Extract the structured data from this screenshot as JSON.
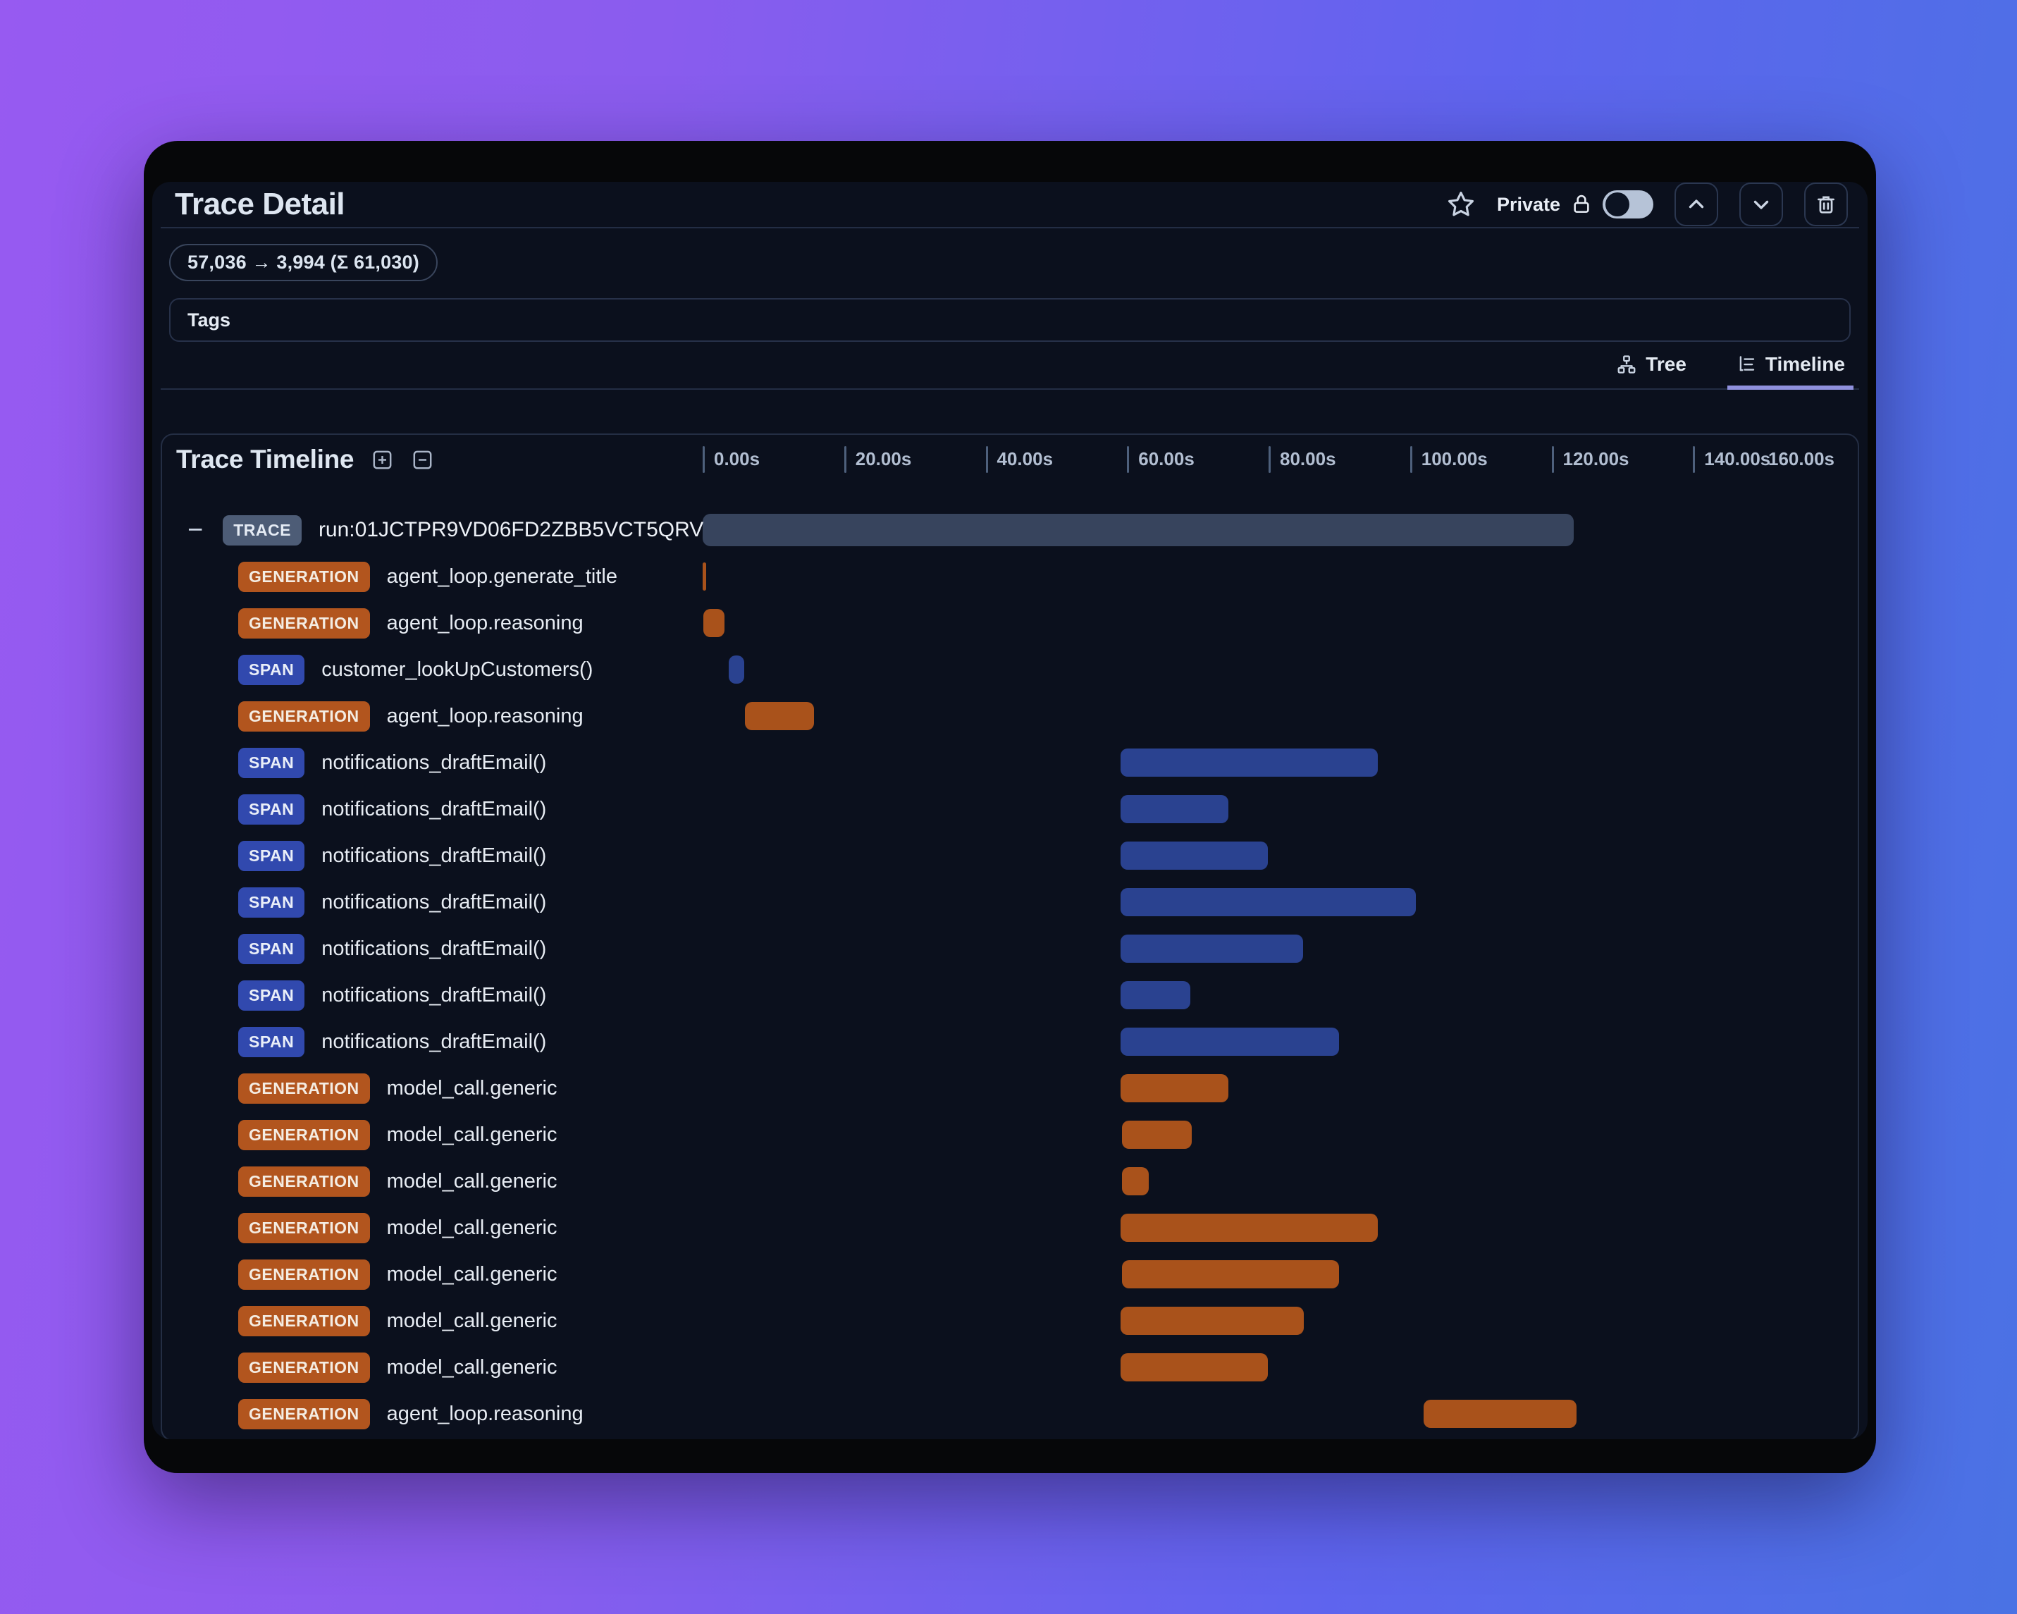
{
  "header": {
    "title": "Trace Detail",
    "privacy_label": "Private",
    "bookmark_icon": "star-icon",
    "lock_icon": "lock-icon",
    "toggle_state": "off",
    "actions": {
      "up": "chevron-up",
      "down": "chevron-down",
      "delete": "trash"
    }
  },
  "token_usage": "57,036 → 3,994 (Σ 61,030)",
  "tags": {
    "label": "Tags"
  },
  "view_tabs": [
    {
      "label": "Tree",
      "active": false
    },
    {
      "label": "Timeline",
      "active": true
    }
  ],
  "timeline": {
    "title": "Trace Timeline",
    "axis": {
      "ticks": [
        "0.00s",
        "20.00s",
        "40.00s",
        "60.00s",
        "80.00s",
        "100.00s",
        "120.00s",
        "140.00s",
        "160.00s"
      ],
      "min_s": 0,
      "max_s": 160,
      "step_s": 20
    },
    "rows": [
      {
        "type": "TRACE",
        "kind": "trace",
        "badge": "TRACE",
        "label": "run:01JCTPR9VD06FD2ZBB5VCT5QRV",
        "start_s": 0.0,
        "end_s": 123.1
      },
      {
        "type": "GENERATION",
        "kind": "generation",
        "badge": "GENERATION",
        "label": "agent_loop.generate_title",
        "start_s": 0.0,
        "end_s": 0.5
      },
      {
        "type": "GENERATION",
        "kind": "generation",
        "badge": "GENERATION",
        "label": "agent_loop.reasoning",
        "start_s": 0.1,
        "end_s": 3.1
      },
      {
        "type": "SPAN",
        "kind": "span",
        "badge": "SPAN",
        "label": "customer_lookUpCustomers()",
        "start_s": 3.7,
        "end_s": 5.9
      },
      {
        "type": "GENERATION",
        "kind": "generation",
        "badge": "GENERATION",
        "label": "agent_loop.reasoning",
        "start_s": 6.0,
        "end_s": 15.7
      },
      {
        "type": "SPAN",
        "kind": "span",
        "badge": "SPAN",
        "label": "notifications_draftEmail()",
        "start_s": 59.1,
        "end_s": 95.4
      },
      {
        "type": "SPAN",
        "kind": "span",
        "badge": "SPAN",
        "label": "notifications_draftEmail()",
        "start_s": 59.1,
        "end_s": 74.3
      },
      {
        "type": "SPAN",
        "kind": "span",
        "badge": "SPAN",
        "label": "notifications_draftEmail()",
        "start_s": 59.1,
        "end_s": 79.9
      },
      {
        "type": "SPAN",
        "kind": "span",
        "badge": "SPAN",
        "label": "notifications_draftEmail()",
        "start_s": 59.1,
        "end_s": 100.8
      },
      {
        "type": "SPAN",
        "kind": "span",
        "badge": "SPAN",
        "label": "notifications_draftEmail()",
        "start_s": 59.1,
        "end_s": 84.9
      },
      {
        "type": "SPAN",
        "kind": "span",
        "badge": "SPAN",
        "label": "notifications_draftEmail()",
        "start_s": 59.1,
        "end_s": 68.9
      },
      {
        "type": "SPAN",
        "kind": "span",
        "badge": "SPAN",
        "label": "notifications_draftEmail()",
        "start_s": 59.1,
        "end_s": 90.0
      },
      {
        "type": "GENERATION",
        "kind": "generation",
        "badge": "GENERATION",
        "label": "model_call.generic",
        "start_s": 59.1,
        "end_s": 74.3
      },
      {
        "type": "GENERATION",
        "kind": "generation",
        "badge": "GENERATION",
        "label": "model_call.generic",
        "start_s": 59.3,
        "end_s": 69.1
      },
      {
        "type": "GENERATION",
        "kind": "generation",
        "badge": "GENERATION",
        "label": "model_call.generic",
        "start_s": 59.3,
        "end_s": 63.1
      },
      {
        "type": "GENERATION",
        "kind": "generation",
        "badge": "GENERATION",
        "label": "model_call.generic",
        "start_s": 59.1,
        "end_s": 95.4
      },
      {
        "type": "GENERATION",
        "kind": "generation",
        "badge": "GENERATION",
        "label": "model_call.generic",
        "start_s": 59.3,
        "end_s": 90.0
      },
      {
        "type": "GENERATION",
        "kind": "generation",
        "badge": "GENERATION",
        "label": "model_call.generic",
        "start_s": 59.1,
        "end_s": 85.0
      },
      {
        "type": "GENERATION",
        "kind": "generation",
        "badge": "GENERATION",
        "label": "model_call.generic",
        "start_s": 59.1,
        "end_s": 79.9
      },
      {
        "type": "GENERATION",
        "kind": "generation",
        "badge": "GENERATION",
        "label": "agent_loop.reasoning",
        "start_s": 101.9,
        "end_s": 123.5
      }
    ]
  },
  "colors": {
    "background_gradient_left": "#975af1",
    "background_gradient_right": "#4a72e4",
    "panel_frame": "#060709",
    "panel_bg": "#0b101d",
    "accent_tab_underline": "#8f90dd",
    "badge_trace": "#4d5c76",
    "badge_generation": "#b2551e",
    "badge_span": "#3149ae",
    "bar_trace": "#37445d",
    "bar_generation": "#a9521b",
    "bar_span": "#2a4290",
    "toggle_track": "#b6c3d7",
    "toggle_knob": "#0c1322"
  }
}
